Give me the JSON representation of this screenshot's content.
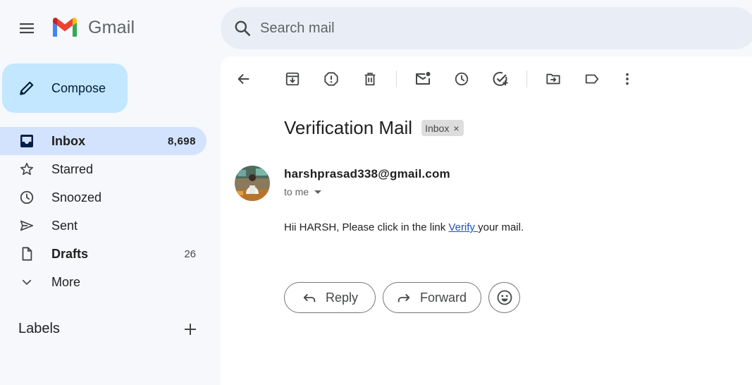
{
  "app": {
    "name": "Gmail"
  },
  "search": {
    "placeholder": "Search mail"
  },
  "compose": {
    "label": "Compose"
  },
  "sidebar": {
    "items": [
      {
        "label": "Inbox",
        "count": "8,698",
        "icon": "inbox-icon",
        "active": true
      },
      {
        "label": "Starred",
        "count": "",
        "icon": "star-icon"
      },
      {
        "label": "Snoozed",
        "count": "",
        "icon": "clock-icon"
      },
      {
        "label": "Sent",
        "count": "",
        "icon": "send-icon"
      },
      {
        "label": "Drafts",
        "count": "26",
        "icon": "draft-icon"
      },
      {
        "label": "More",
        "count": "",
        "icon": "chevron-down-icon"
      }
    ],
    "labels_heading": "Labels"
  },
  "toolbar": {
    "icons": [
      "back-arrow-icon",
      "archive-icon",
      "report-spam-icon",
      "delete-icon",
      "mark-unread-icon",
      "snooze-icon",
      "add-to-tasks-icon",
      "move-to-icon",
      "label-icon",
      "more-options-icon"
    ]
  },
  "message": {
    "subject": "Verification Mail",
    "label_chip": "Inbox",
    "chip_close": "×",
    "sender": "harshprasad338@gmail.com",
    "to": "to me",
    "body_before": "Hii HARSH, Please click in the link ",
    "link_text": "Verify ",
    "body_after": "your mail."
  },
  "actions": {
    "reply": "Reply",
    "forward": "Forward",
    "emoji_icon": "emoji-smile-icon"
  },
  "colors": {
    "background": "#f6f8fc",
    "compose_bg": "#c2e7ff",
    "active_nav": "#d3e3fd",
    "search_bg": "#e9eef6",
    "link": "#1155cc"
  }
}
